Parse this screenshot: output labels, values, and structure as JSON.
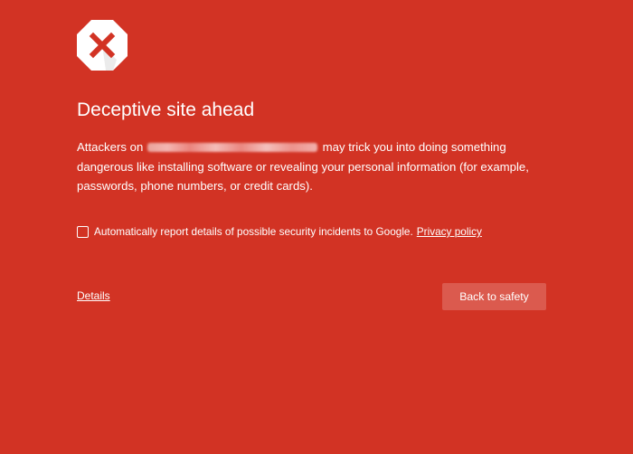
{
  "warning": {
    "icon": "red-x-octagon-icon",
    "title": "Deceptive site ahead",
    "message_before_url": "Attackers on",
    "url_redacted": "",
    "message_after_url": "may trick you into doing something dangerous like installing software or revealing your personal information (for example, passwords, phone numbers, or credit cards)."
  },
  "report": {
    "checked": false,
    "label": "Automatically report details of possible security incidents to Google.",
    "privacy_link": "Privacy policy"
  },
  "actions": {
    "details_link": "Details",
    "back_button": "Back to safety"
  },
  "colors": {
    "background": "#d23324",
    "button": "#db5a4e",
    "icon_x": "#d23324",
    "icon_bg": "#ffffff"
  }
}
